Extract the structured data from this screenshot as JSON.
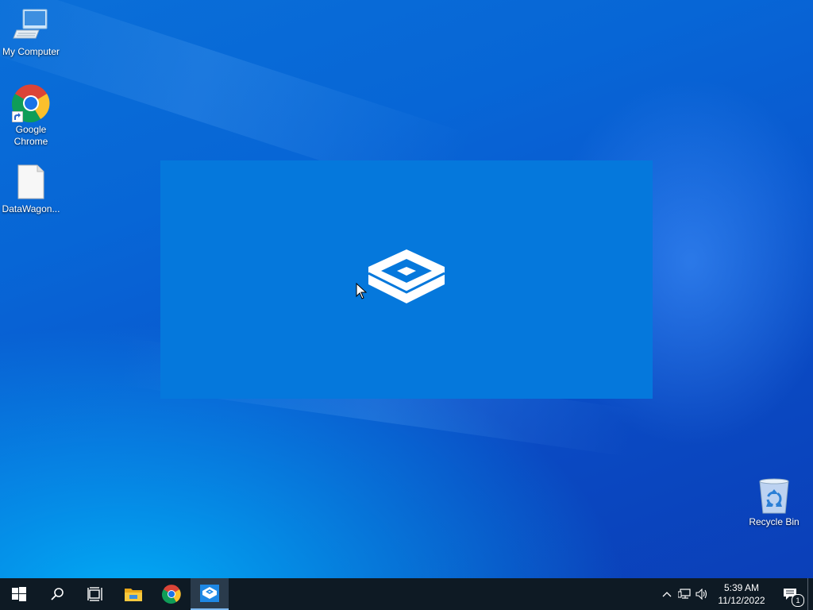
{
  "desktop": {
    "icons": [
      {
        "label": "My Computer",
        "icon": "computer-icon"
      },
      {
        "label": "Google Chrome",
        "icon": "chrome-icon"
      },
      {
        "label": "DataWagon...",
        "icon": "file-icon"
      },
      {
        "label": "Recycle Bin",
        "icon": "recycle-bin-icon"
      }
    ]
  },
  "splash": {
    "icon": "sandbox-box-icon",
    "background": "#0578dc"
  },
  "taskbar": {
    "buttons": [
      {
        "name": "start",
        "icon": "windows-logo-icon"
      },
      {
        "name": "search",
        "icon": "search-icon"
      },
      {
        "name": "task-view",
        "icon": "task-view-icon"
      },
      {
        "name": "file-explorer",
        "icon": "folder-icon"
      },
      {
        "name": "chrome",
        "icon": "chrome-icon"
      },
      {
        "name": "sandbox",
        "icon": "sandbox-box-icon",
        "active": true
      }
    ],
    "tray": {
      "icons": [
        "chevron-up-icon",
        "network-icon",
        "volume-icon"
      ],
      "time": "5:39 AM",
      "date": "11/12/2022",
      "notification_count": "1"
    }
  },
  "colors": {
    "taskbar": "#0e1a24",
    "accent": "#0578dc"
  }
}
